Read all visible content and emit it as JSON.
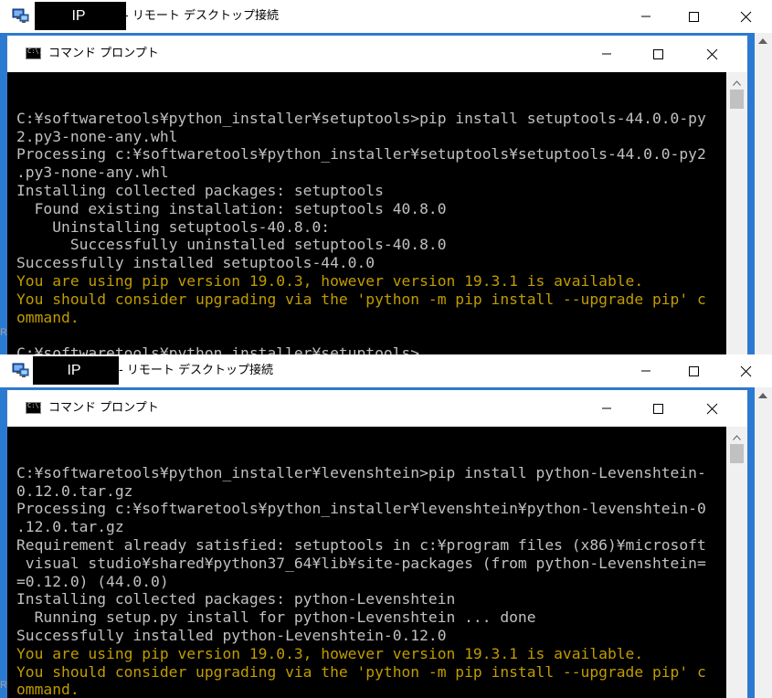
{
  "windows": [
    {
      "rdp_ip": "IP",
      "rdp_title": "- リモート デスクトップ接続",
      "cmd_title": "コマンド プロンプト",
      "icon_text": "C:\\.",
      "cursor": true,
      "left_edge_char": "R",
      "lines": [
        {
          "text": "",
          "warn": false
        },
        {
          "text": "C:¥softwaretools¥python_installer¥setuptools>pip install setuptools-44.0.0-py",
          "warn": false
        },
        {
          "text": "2.py3-none-any.whl",
          "warn": false
        },
        {
          "text": "Processing c:¥softwaretools¥python_installer¥setuptools¥setuptools-44.0.0-py2",
          "warn": false
        },
        {
          "text": ".py3-none-any.whl",
          "warn": false
        },
        {
          "text": "Installing collected packages: setuptools",
          "warn": false
        },
        {
          "text": "  Found existing installation: setuptools 40.8.0",
          "warn": false
        },
        {
          "text": "    Uninstalling setuptools-40.8.0:",
          "warn": false
        },
        {
          "text": "      Successfully uninstalled setuptools-40.8.0",
          "warn": false
        },
        {
          "text": "Successfully installed setuptools-44.0.0",
          "warn": false
        },
        {
          "text": "You are using pip version 19.0.3, however version 19.3.1 is available.",
          "warn": true
        },
        {
          "text": "You should consider upgrading via the 'python -m pip install --upgrade pip' c",
          "warn": true
        },
        {
          "text": "ommand.",
          "warn": true
        },
        {
          "text": "",
          "warn": false
        },
        {
          "text": "C:¥softwaretools¥python_installer¥setuptools>",
          "warn": false
        }
      ]
    },
    {
      "rdp_ip": "IP",
      "rdp_title": "- リモート デスクトップ接続",
      "cmd_title": "コマンド プロンプト",
      "icon_text": "C:\\.",
      "cursor": false,
      "left_edge_char": "R",
      "lines": [
        {
          "text": "",
          "warn": false
        },
        {
          "text": "C:¥softwaretools¥python_installer¥levenshtein>pip install python-Levenshtein-",
          "warn": false
        },
        {
          "text": "0.12.0.tar.gz",
          "warn": false
        },
        {
          "text": "Processing c:¥softwaretools¥python_installer¥levenshtein¥python-levenshtein-0",
          "warn": false
        },
        {
          "text": ".12.0.tar.gz",
          "warn": false
        },
        {
          "text": "Requirement already satisfied: setuptools in c:¥program files (x86)¥microsoft",
          "warn": false
        },
        {
          "text": " visual studio¥shared¥python37_64¥lib¥site-packages (from python-Levenshtein=",
          "warn": false
        },
        {
          "text": "=0.12.0) (44.0.0)",
          "warn": false
        },
        {
          "text": "Installing collected packages: python-Levenshtein",
          "warn": false
        },
        {
          "text": "  Running setup.py install for python-Levenshtein ... done",
          "warn": false
        },
        {
          "text": "Successfully installed python-Levenshtein-0.12.0",
          "warn": false
        },
        {
          "text": "You are using pip version 19.0.3, however version 19.3.1 is available.",
          "warn": true
        },
        {
          "text": "You should consider upgrading via the 'python -m pip install --upgrade pip' c",
          "warn": true
        },
        {
          "text": "ommand.",
          "warn": true
        }
      ]
    }
  ],
  "colors": {
    "console_bg": "#000000",
    "console_text": "#c0c0c0",
    "warning_text": "#c19c00",
    "desktop": "#2a7ad2"
  }
}
